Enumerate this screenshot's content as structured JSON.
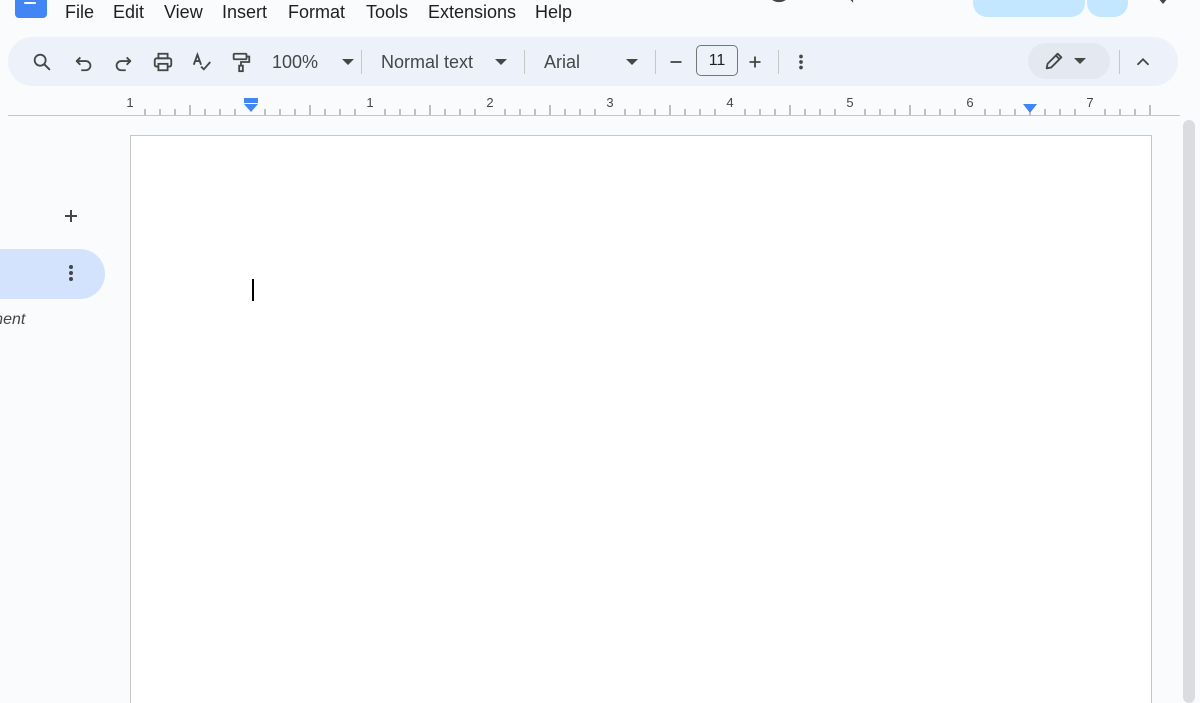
{
  "menubar": {
    "items": [
      "File",
      "Edit",
      "View",
      "Insert",
      "Format",
      "Tools",
      "Extensions",
      "Help"
    ]
  },
  "toolbar": {
    "search_icon": "search-icon",
    "undo_icon": "undo-icon",
    "redo_icon": "redo-icon",
    "print_icon": "print-icon",
    "spellcheck_icon": "spellcheck-icon",
    "paint_format_icon": "paint-format-icon",
    "zoom": "100%",
    "style": "Normal text",
    "font": "Arial",
    "font_size": "11",
    "decrease_icon": "minus-icon",
    "increase_icon": "plus-icon",
    "more_icon": "more-vert-icon",
    "edit_mode_icon": "pencil-icon",
    "collapse_icon": "chevron-up-icon"
  },
  "ruler": {
    "labels": [
      "1",
      "1",
      "2",
      "3",
      "4",
      "5",
      "6",
      "7"
    ],
    "accent": "#4285f4"
  },
  "outline": {
    "tab_label": "ocument"
  },
  "colors": {
    "accent": "#4285f4",
    "toolbar_bg": "#edf2fa",
    "share_bg": "#c2e7ff",
    "outline_tab_bg": "#d3e3fd"
  }
}
